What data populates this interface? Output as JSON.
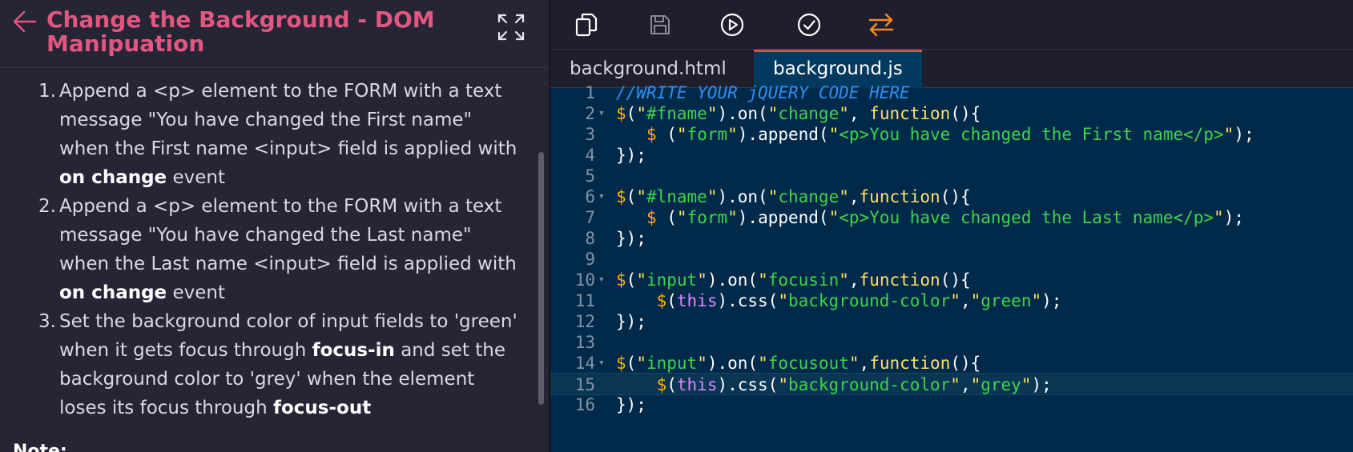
{
  "header": {
    "title": "Change the Background - DOM Manipuation"
  },
  "instructions": [
    {
      "num": "1.",
      "parts": [
        "Append a <p> element to the FORM with a text message \"You have changed the First name\" when the First name <input> field is applied with ",
        "on change",
        " event"
      ]
    },
    {
      "num": "2.",
      "parts": [
        "Append a <p> element to the FORM with a text message  \"You have changed the Last name\" when the Last name <input> field is applied with ",
        "on change",
        " event"
      ]
    },
    {
      "num": "3.",
      "parts": [
        "Set the background color of input fields to 'green' when it gets focus through ",
        "focus-in",
        " and set the background color to 'grey' when the element loses its focus through ",
        "focus-out",
        ""
      ]
    }
  ],
  "note_label": "Note:",
  "toolbar": {
    "buttons": [
      {
        "icon": "copy-icon"
      },
      {
        "icon": "save-icon"
      },
      {
        "icon": "run-icon"
      },
      {
        "icon": "submit-check-icon"
      },
      {
        "icon": "swap-icon"
      }
    ],
    "accent": "#f08a24"
  },
  "tabs": [
    {
      "label": "background.html",
      "active": false
    },
    {
      "label": "background.js",
      "active": true
    }
  ],
  "editor": {
    "current_line": 15,
    "lines": [
      {
        "n": "1",
        "fold": false,
        "tokens": [
          [
            "c-comment",
            "//WRITE YOUR jQUERY CODE HERE"
          ]
        ]
      },
      {
        "n": "2",
        "fold": true,
        "tokens": [
          [
            "c-dollar",
            "$"
          ],
          [
            "c-w",
            "("
          ],
          [
            "c-strq",
            "\""
          ],
          [
            "c-str",
            "#fname"
          ],
          [
            "c-strq",
            "\""
          ],
          [
            "c-w",
            ").on("
          ],
          [
            "c-strq",
            "\""
          ],
          [
            "c-str",
            "change"
          ],
          [
            "c-strq",
            "\""
          ],
          [
            "c-w",
            ", "
          ],
          [
            "c-fn",
            "function"
          ],
          [
            "c-w",
            "(){"
          ]
        ]
      },
      {
        "n": "3",
        "fold": false,
        "tokens": [
          [
            "c-w",
            "   "
          ],
          [
            "c-dollar",
            "$"
          ],
          [
            "c-w",
            " ("
          ],
          [
            "c-strq",
            "\""
          ],
          [
            "c-str",
            "form"
          ],
          [
            "c-strq",
            "\""
          ],
          [
            "c-w",
            ").append("
          ],
          [
            "c-strq",
            "\""
          ],
          [
            "c-str",
            "<p>You have changed the First name</p>"
          ],
          [
            "c-strq",
            "\""
          ],
          [
            "c-w",
            ");"
          ]
        ]
      },
      {
        "n": "4",
        "fold": false,
        "tokens": [
          [
            "c-w",
            "});"
          ]
        ]
      },
      {
        "n": "5",
        "fold": false,
        "tokens": []
      },
      {
        "n": "6",
        "fold": true,
        "tokens": [
          [
            "c-dollar",
            "$"
          ],
          [
            "c-w",
            "("
          ],
          [
            "c-strq",
            "\""
          ],
          [
            "c-str",
            "#lname"
          ],
          [
            "c-strq",
            "\""
          ],
          [
            "c-w",
            ").on("
          ],
          [
            "c-strq",
            "\""
          ],
          [
            "c-str",
            "change"
          ],
          [
            "c-strq",
            "\""
          ],
          [
            "c-w",
            ","
          ],
          [
            "c-fn",
            "function"
          ],
          [
            "c-w",
            "(){"
          ]
        ]
      },
      {
        "n": "7",
        "fold": false,
        "tokens": [
          [
            "c-w",
            "   "
          ],
          [
            "c-dollar",
            "$"
          ],
          [
            "c-w",
            " ("
          ],
          [
            "c-strq",
            "\""
          ],
          [
            "c-str",
            "form"
          ],
          [
            "c-strq",
            "\""
          ],
          [
            "c-w",
            ").append("
          ],
          [
            "c-strq",
            "\""
          ],
          [
            "c-str",
            "<p>You have changed the Last name</p>"
          ],
          [
            "c-strq",
            "\""
          ],
          [
            "c-w",
            ");"
          ]
        ]
      },
      {
        "n": "8",
        "fold": false,
        "tokens": [
          [
            "c-w",
            "});"
          ]
        ]
      },
      {
        "n": "9",
        "fold": false,
        "tokens": []
      },
      {
        "n": "10",
        "fold": true,
        "tokens": [
          [
            "c-dollar",
            "$"
          ],
          [
            "c-w",
            "("
          ],
          [
            "c-strq",
            "\""
          ],
          [
            "c-str",
            "input"
          ],
          [
            "c-strq",
            "\""
          ],
          [
            "c-w",
            ").on("
          ],
          [
            "c-strq",
            "\""
          ],
          [
            "c-str",
            "focusin"
          ],
          [
            "c-strq",
            "\""
          ],
          [
            "c-w",
            ","
          ],
          [
            "c-fn",
            "function"
          ],
          [
            "c-w",
            "(){"
          ]
        ]
      },
      {
        "n": "11",
        "fold": false,
        "tokens": [
          [
            "c-w",
            "    "
          ],
          [
            "c-dollar",
            "$"
          ],
          [
            "c-w",
            "("
          ],
          [
            "c-this",
            "this"
          ],
          [
            "c-w",
            ").css("
          ],
          [
            "c-strq",
            "\""
          ],
          [
            "c-str",
            "background-color"
          ],
          [
            "c-strq",
            "\""
          ],
          [
            "c-w",
            ","
          ],
          [
            "c-strq",
            "\""
          ],
          [
            "c-str",
            "green"
          ],
          [
            "c-strq",
            "\""
          ],
          [
            "c-w",
            ");"
          ]
        ]
      },
      {
        "n": "12",
        "fold": false,
        "tokens": [
          [
            "c-w",
            "});"
          ]
        ]
      },
      {
        "n": "13",
        "fold": false,
        "tokens": []
      },
      {
        "n": "14",
        "fold": true,
        "tokens": [
          [
            "c-dollar",
            "$"
          ],
          [
            "c-w",
            "("
          ],
          [
            "c-strq",
            "\""
          ],
          [
            "c-str",
            "input"
          ],
          [
            "c-strq",
            "\""
          ],
          [
            "c-w",
            ").on("
          ],
          [
            "c-strq",
            "\""
          ],
          [
            "c-str",
            "focusout"
          ],
          [
            "c-strq",
            "\""
          ],
          [
            "c-w",
            ","
          ],
          [
            "c-fn",
            "function"
          ],
          [
            "c-w",
            "(){"
          ]
        ]
      },
      {
        "n": "15",
        "fold": false,
        "tokens": [
          [
            "c-w",
            "    "
          ],
          [
            "c-dollar",
            "$"
          ],
          [
            "c-w",
            "("
          ],
          [
            "c-this",
            "this"
          ],
          [
            "c-w",
            ").css("
          ],
          [
            "c-strq",
            "\""
          ],
          [
            "c-str",
            "background-color"
          ],
          [
            "c-strq",
            "\""
          ],
          [
            "c-w",
            ","
          ],
          [
            "c-strq",
            "\""
          ],
          [
            "c-str",
            "grey"
          ],
          [
            "c-strq",
            "\""
          ],
          [
            "c-w",
            ");"
          ]
        ]
      },
      {
        "n": "16",
        "fold": false,
        "tokens": [
          [
            "c-w",
            "});"
          ]
        ]
      }
    ]
  }
}
